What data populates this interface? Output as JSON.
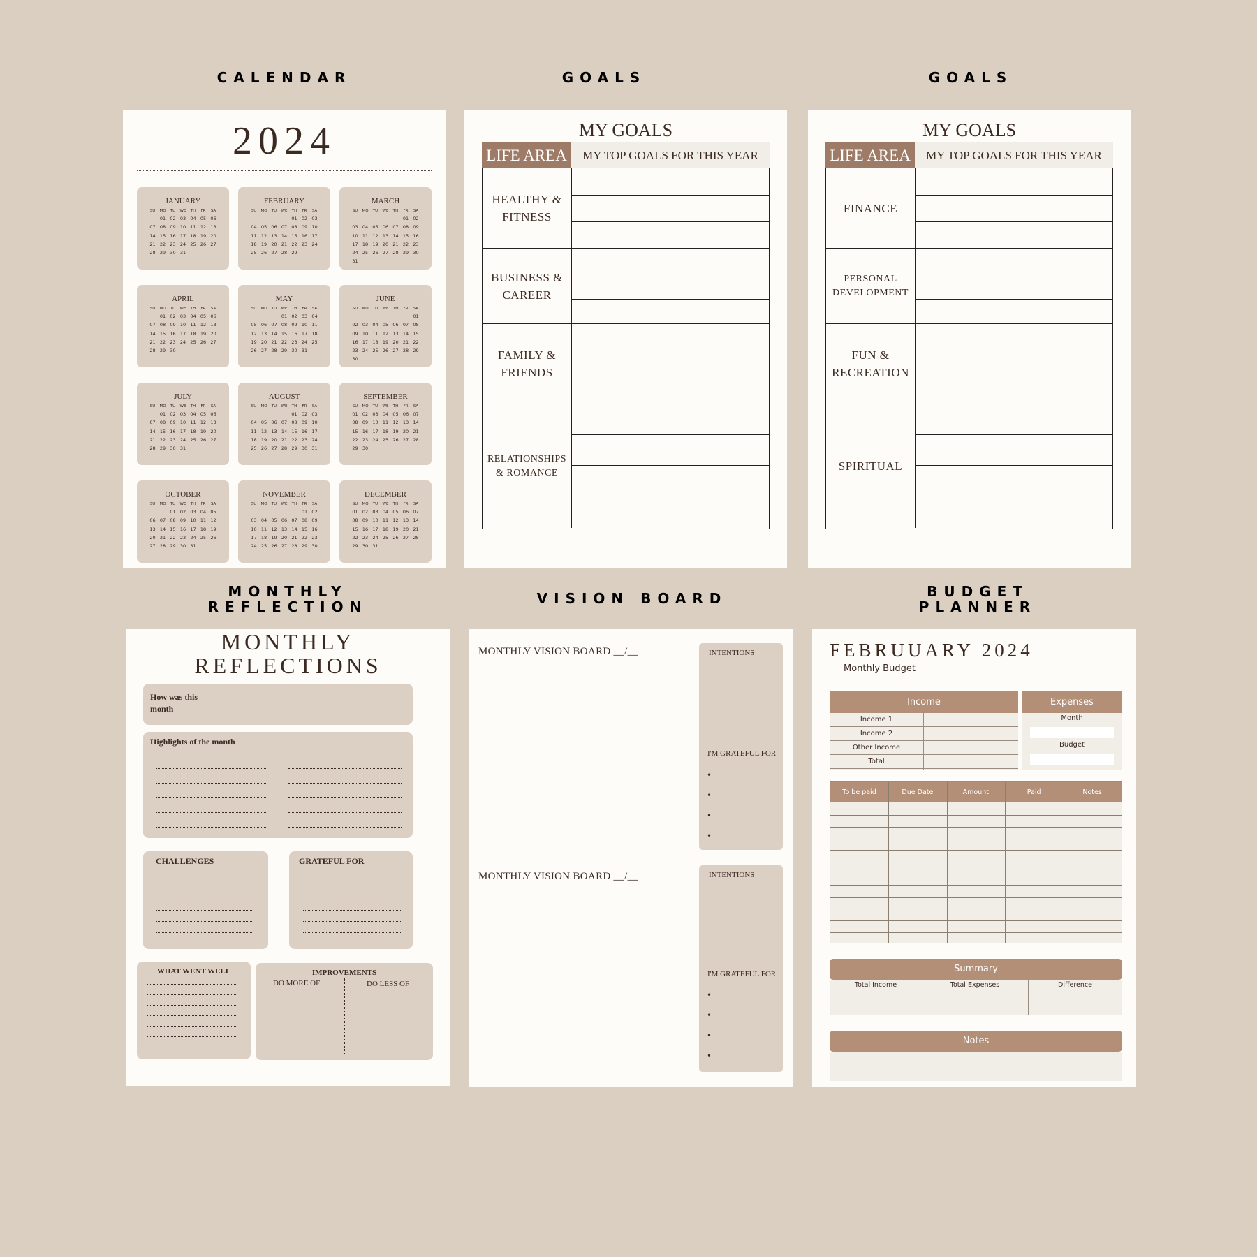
{
  "headers": {
    "calendar": "CALENDAR",
    "goals_1": "GOALS",
    "goals_2": "GOALS",
    "monthly_reflection_1": "MONTHLY",
    "monthly_reflection_2": "REFLECTION",
    "vision_board": "VISION BOARD",
    "budget_planner_1": "BUDGET",
    "budget_planner_2": "PLANNER"
  },
  "calendar": {
    "year": "2024",
    "day_names": [
      "SU",
      "MO",
      "TU",
      "WE",
      "TH",
      "FR",
      "SA"
    ],
    "months": [
      {
        "name": "JANUARY",
        "start": 1,
        "days": 31
      },
      {
        "name": "FEBRUARY",
        "start": 4,
        "days": 29
      },
      {
        "name": "MARCH",
        "start": 5,
        "days": 31
      },
      {
        "name": "APRIL",
        "start": 1,
        "days": 30
      },
      {
        "name": "MAY",
        "start": 3,
        "days": 31
      },
      {
        "name": "JUNE",
        "start": 6,
        "days": 30
      },
      {
        "name": "JULY",
        "start": 1,
        "days": 31
      },
      {
        "name": "AUGUST",
        "start": 4,
        "days": 31
      },
      {
        "name": "SEPTEMBER",
        "start": 0,
        "days": 30
      },
      {
        "name": "OCTOBER",
        "start": 2,
        "days": 31
      },
      {
        "name": "NOVEMBER",
        "start": 5,
        "days": 30
      },
      {
        "name": "DECEMBER",
        "start": 0,
        "days": 31
      }
    ]
  },
  "goals_1": {
    "title": "MY GOALS",
    "life_area": "LIFE AREA",
    "top_goals": "MY TOP GOALS FOR THIS YEAR",
    "areas": [
      "HEALTHY &\nFITNESS",
      "BUSINESS &\nCAREER",
      "FAMILY &\nFRIENDS",
      "RELATIONSHIPS\n& ROMANCE"
    ]
  },
  "goals_2": {
    "title": "MY GOALS",
    "life_area": "LIFE AREA",
    "top_goals": "MY TOP GOALS FOR THIS YEAR",
    "areas": [
      "FINANCE",
      "PERSONAL\nDEVELOPMENT",
      "FUN &\nRECREATION",
      "SPIRITUAL"
    ]
  },
  "reflection": {
    "title_1": "MONTHLY",
    "title_2": "REFLECTIONS",
    "how_was": "How was this month",
    "highlights": "Highlights of the month",
    "challenges": "CHALLENGES",
    "grateful": "GRATEFUL FOR",
    "went_well": "WHAT WENT WELL",
    "improvements": "IMPROVEMENTS",
    "do_more": "DO MORE OF",
    "do_less": "DO LESS OF"
  },
  "vision": {
    "board_label": "MONTHLY VISION BOARD __/__",
    "intentions": "INTENTIONS",
    "grateful": "I'M GRATEFUL FOR",
    "bullet": "•"
  },
  "budget": {
    "title": "FEBRUUARY 2024",
    "subtitle": "Monthly Budget",
    "income": "Income",
    "expenses": "Expenses",
    "income_rows": [
      "Income 1",
      "Income 2",
      "Other Income",
      "Total"
    ],
    "month": "Month",
    "budget": "Budget",
    "columns": [
      "To be paid",
      "Due Date",
      "Amount",
      "Paid",
      "Notes"
    ],
    "summary": "Summary",
    "summary_cols": [
      "Total Income",
      "Total Expenses",
      "Difference"
    ],
    "notes": "Notes"
  }
}
